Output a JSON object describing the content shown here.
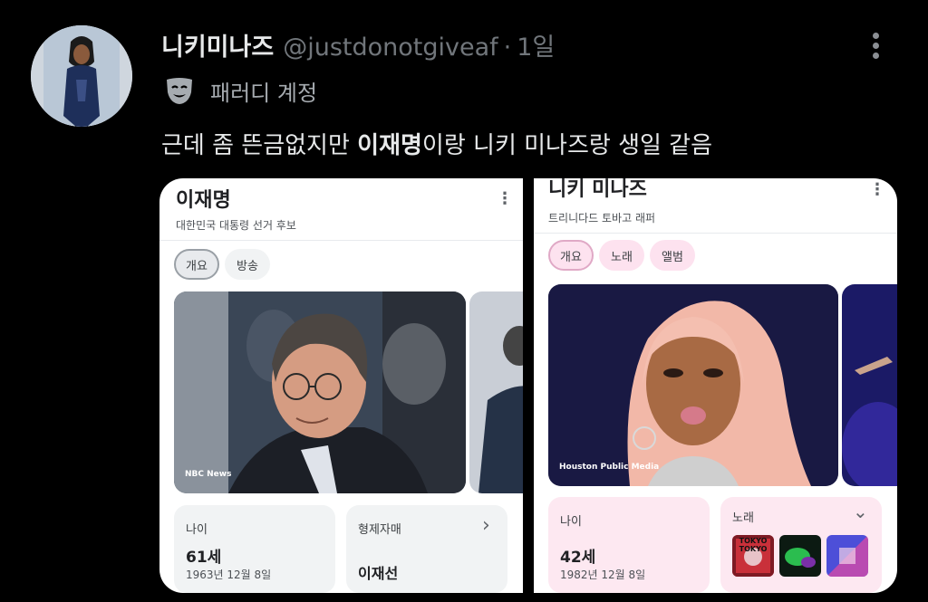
{
  "tweet": {
    "display_name": "니키미나즈",
    "handle": "@justdonotgiveaf",
    "separator": "·",
    "time": "1일",
    "badge_icon": "theater-mask-icon",
    "badge_label": "패러디 계정",
    "text_before": "근데 좀 뜬금없지만 ",
    "text_bold": "이재명",
    "text_after": "이랑 니키 미나즈랑 생일 같음"
  },
  "left_card": {
    "title": "이재명",
    "subtitle": "대한민국 대통령 선거 후보",
    "tabs": [
      "개요",
      "방송"
    ],
    "photo_credit": "NBC News",
    "age_label": "나이",
    "age_value": "61세",
    "birth_date": "1963년 12월 8일",
    "sibling_label": "형제자매",
    "sibling_name": "이재선",
    "chevron": "›"
  },
  "right_card": {
    "title": "니키 미나즈",
    "subtitle": "트리니다드 토바고 래퍼",
    "tabs": [
      "개요",
      "노래",
      "앨범"
    ],
    "photo_credit": "Houston Public Media",
    "age_label": "나이",
    "age_value": "42세",
    "birth_date": "1982년 12월 8일",
    "songs_label": "노래",
    "chevron": "⌄",
    "thumb_text": "TOKYO TOKYO"
  },
  "colors": {
    "background": "#000000",
    "text_primary": "#e7e9ea",
    "text_secondary": "#71767b",
    "chip_pink": "#fde2ef",
    "chip_gray": "#f1f3f4"
  }
}
